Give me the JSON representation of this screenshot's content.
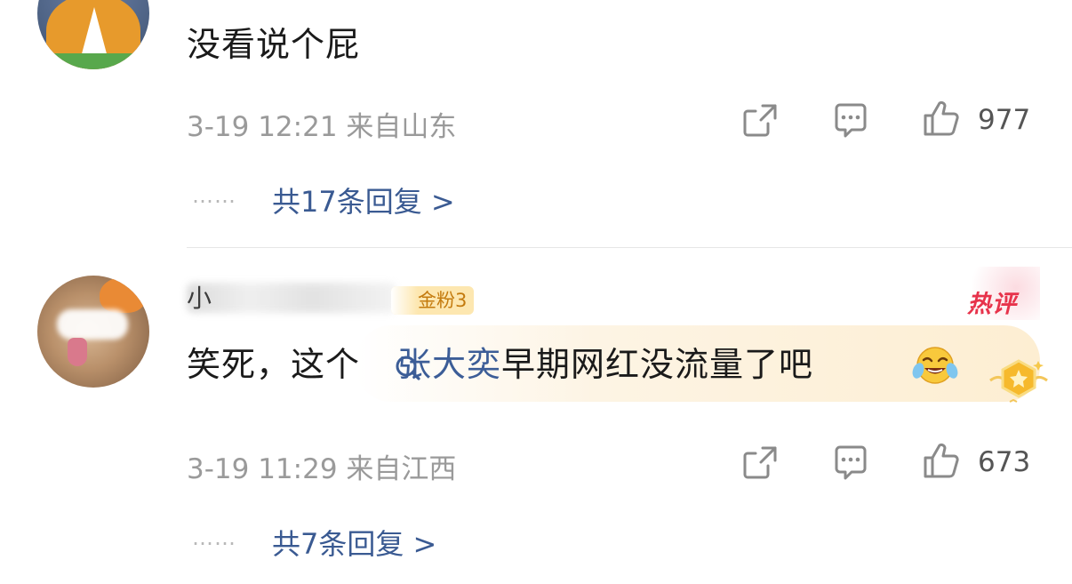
{
  "comments": [
    {
      "text": "没看说个屁",
      "meta": "3-19 12:21 来自山东",
      "like_count": "977",
      "replies_label": "共17条回复 >",
      "dots": "……"
    },
    {
      "username_visible": "小",
      "fans_badge": "金粉3",
      "hot_tag": "热评",
      "text_before": "笑死，这个",
      "link_text": "张大奕",
      "text_after": "早期网红没流量了吧",
      "meta": "3-19 11:29 来自江西",
      "like_count": "673",
      "replies_label": "共7条回复 >",
      "dots": "……"
    }
  ],
  "colors": {
    "link": "#3c5d97",
    "hot": "#e7334b",
    "meta": "#9a9a9a",
    "badge": "#c47b0e"
  },
  "icons": [
    "share-icon",
    "comment-icon",
    "thumbs-up-icon",
    "search-icon",
    "laughing-emoji-icon",
    "medal-badge-icon"
  ]
}
